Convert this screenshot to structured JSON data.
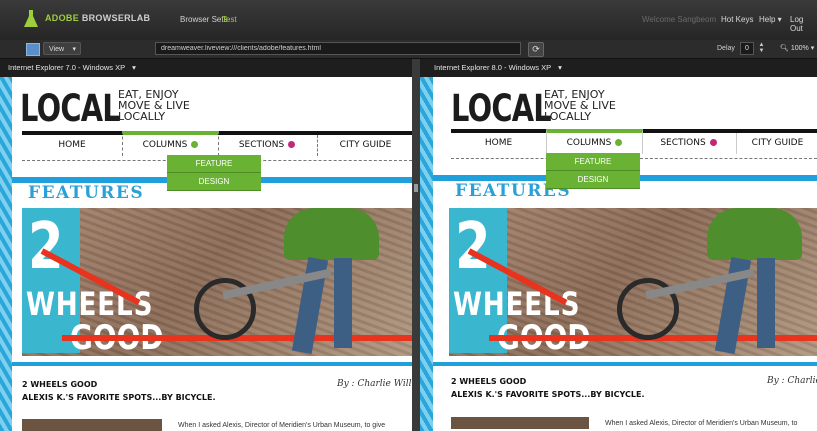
{
  "app": {
    "brand": "ADOBE",
    "name": "BROWSERLAB",
    "nav": [
      "Browser Sets",
      "Test"
    ]
  },
  "user_menu": {
    "welcome": "Welcome Sangbeom",
    "hot_keys": "Hot Keys",
    "help": "Help ▾",
    "logout": "Log Out"
  },
  "toolbar": {
    "view_label": "View",
    "url": "dreamweaver.liveview:///clients/adobe/features.html",
    "delay_label": "Delay",
    "delay_value": "0",
    "zoom": "100%"
  },
  "panes": [
    {
      "browser": "Internet Explorer 7.0 - Windows XP"
    },
    {
      "browser": "Internet Explorer 8.0 - Windows XP"
    }
  ],
  "site": {
    "logo": "LOCAL",
    "tagline": "EAT, ENJOY MOVE & LIVE LOCALLY",
    "nav": [
      "HOME",
      "COLUMNS",
      "SECTIONS",
      "CITY GUIDE"
    ],
    "dropdown": [
      "FEATURE",
      "DESIGN"
    ],
    "section_title": "FEATURES",
    "hero": {
      "number": "2",
      "line1": "WHEELS",
      "line2": "GOOD"
    },
    "story_title": "2 WHEELS GOOD",
    "story_sub": "ALEXIS K.'S FAVORITE SPOTS...BY BICYCLE.",
    "byline_left": "By : Charlie Will",
    "byline_right": "By : Charlie",
    "body_left": "When I asked Alexis, Director of Meridien's Urban Museum, to give",
    "body_right": "When I asked Alexis, Director of Meridien's Urban Museum, to"
  },
  "colors": {
    "accent_green": "#9fce3c",
    "nav_green": "#69b234",
    "site_blue": "#1fa0dc",
    "sections_dot": "#c0287a",
    "hero_red": "#e8331e"
  }
}
